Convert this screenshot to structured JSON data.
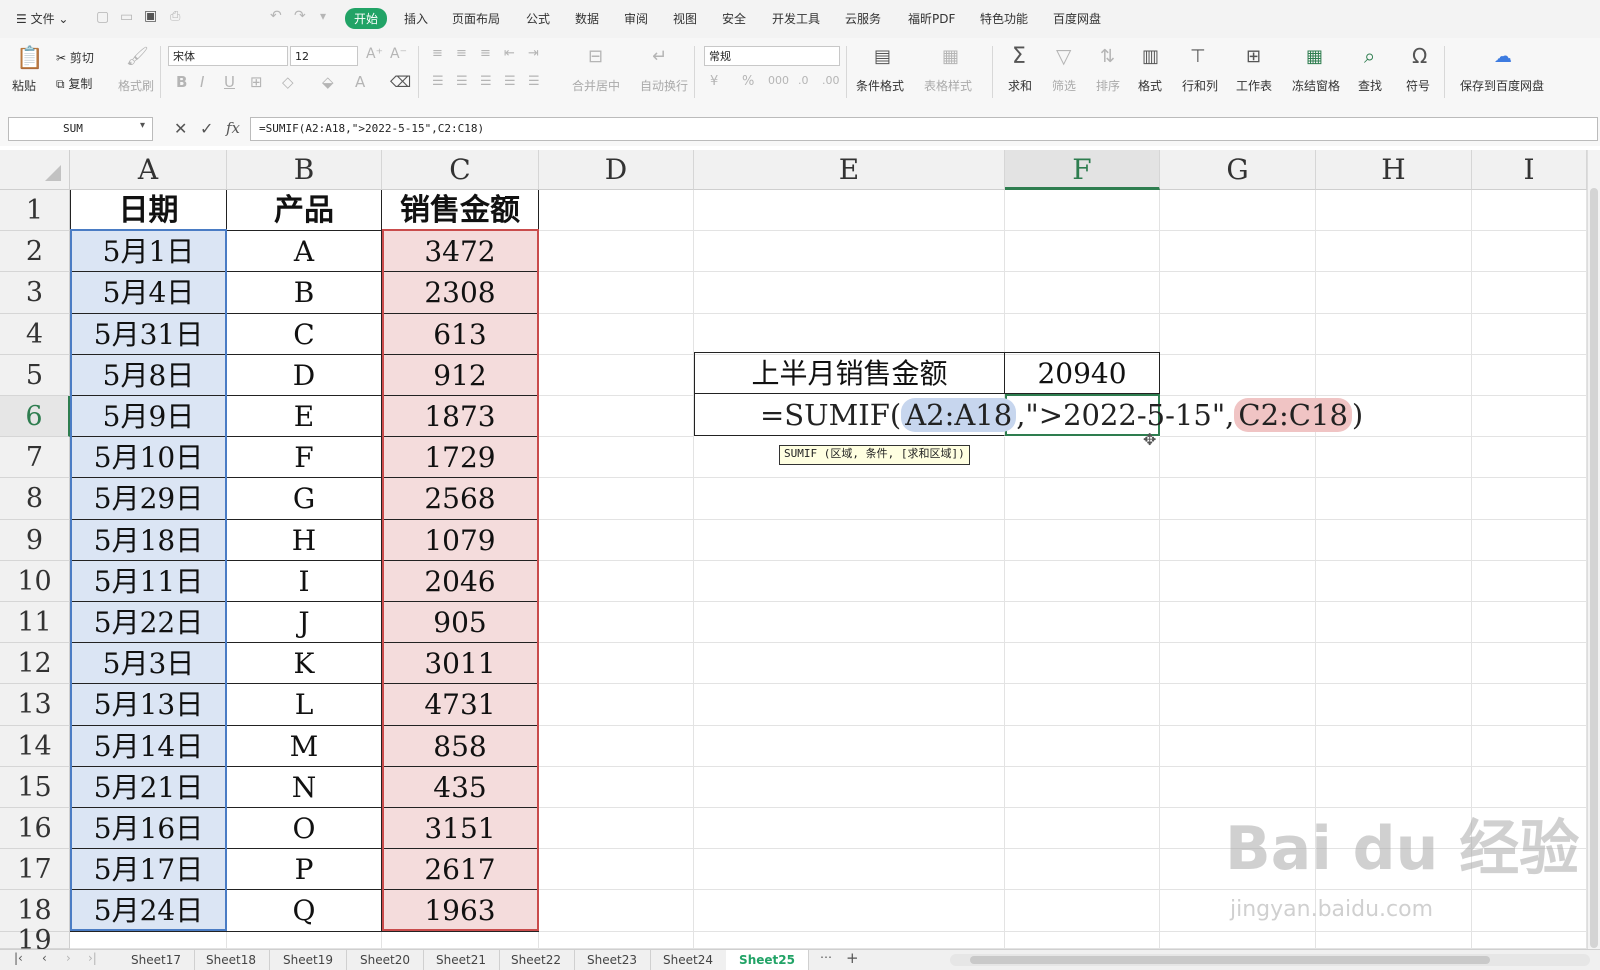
{
  "menu": {
    "file": "文件",
    "tabs": [
      "开始",
      "插入",
      "页面布局",
      "公式",
      "数据",
      "审阅",
      "视图",
      "安全",
      "开发工具",
      "云服务",
      "福昕PDF",
      "特色功能",
      "百度网盘"
    ]
  },
  "toolbar": {
    "paste": "粘贴",
    "cut": "剪切",
    "copy": "复制",
    "format_painter": "格式刷",
    "font_name": "宋体",
    "font_size": "12",
    "merge_center": "合并居中",
    "wrap_text": "自动换行",
    "number_format": "常规",
    "cond_format": "条件格式",
    "table_style": "表格样式",
    "sum": "求和",
    "filter": "筛选",
    "sort": "排序",
    "format": "格式",
    "row_col": "行和列",
    "worksheet": "工作表",
    "freeze": "冻结窗格",
    "find": "查找",
    "symbol": "符号",
    "save_baidu": "保存到百度网盘"
  },
  "formula_bar": {
    "name_box": "SUM",
    "fx_label": "fx",
    "formula": "=SUMIF(A2:A18,\">2022-5-15\",C2:C18)"
  },
  "grid": {
    "columns": [
      "A",
      "B",
      "C",
      "D",
      "E",
      "F",
      "G",
      "H",
      "I"
    ],
    "rows": [
      "1",
      "2",
      "3",
      "4",
      "5",
      "6",
      "7",
      "8",
      "9",
      "10",
      "11",
      "12",
      "13",
      "14",
      "15",
      "16",
      "17",
      "18",
      "19"
    ],
    "headers": [
      "日期",
      "产品",
      "销售金额"
    ],
    "data": [
      [
        "5月1日",
        "A",
        "3472"
      ],
      [
        "5月4日",
        "B",
        "2308"
      ],
      [
        "5月31日",
        "C",
        "613"
      ],
      [
        "5月8日",
        "D",
        "912"
      ],
      [
        "5月9日",
        "E",
        "1873"
      ],
      [
        "5月10日",
        "F",
        "1729"
      ],
      [
        "5月29日",
        "G",
        "2568"
      ],
      [
        "5月18日",
        "H",
        "1079"
      ],
      [
        "5月11日",
        "I",
        "2046"
      ],
      [
        "5月22日",
        "J",
        "905"
      ],
      [
        "5月3日",
        "K",
        "3011"
      ],
      [
        "5月13日",
        "L",
        "4731"
      ],
      [
        "5月14日",
        "M",
        "858"
      ],
      [
        "5月21日",
        "N",
        "435"
      ],
      [
        "5月16日",
        "O",
        "3151"
      ],
      [
        "5月17日",
        "P",
        "2617"
      ],
      [
        "5月24日",
        "Q",
        "1963"
      ]
    ],
    "summary_label": "上半月销售金额",
    "summary_value": "20940",
    "editing": {
      "prefix": "=SUMIF(",
      "ref_a": "A2:A18",
      "middle": ",\">2022-5-15\",",
      "ref_c": "C2:C18",
      "suffix": ")"
    },
    "tooltip": "SUMIF (区域, 条件, [求和区域])"
  },
  "sheets": [
    "Sheet17",
    "Sheet18",
    "Sheet19",
    "Sheet20",
    "Sheet21",
    "Sheet22",
    "Sheet23",
    "Sheet24",
    "Sheet25"
  ],
  "active_sheet": "Sheet25",
  "watermark": {
    "brand": "Bai du 经验",
    "url": "jingyan.baidu.com"
  }
}
